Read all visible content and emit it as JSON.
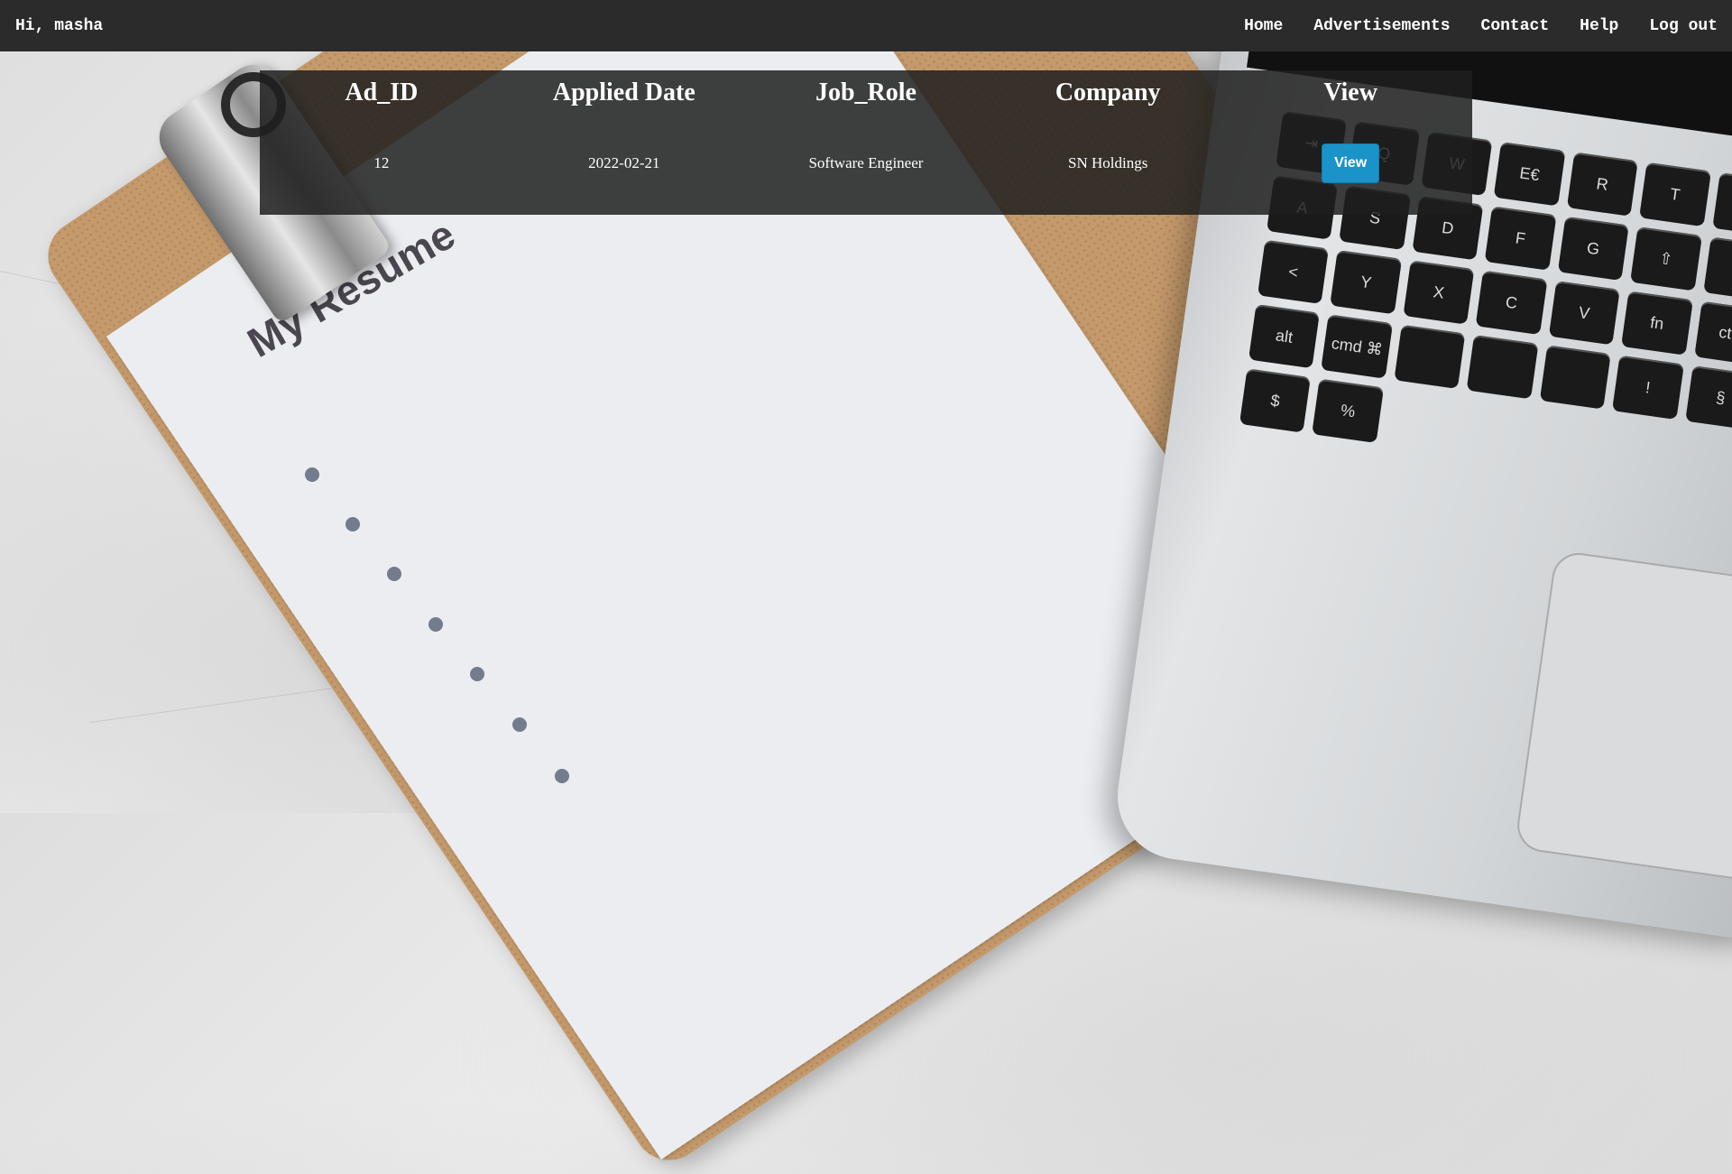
{
  "navbar": {
    "greeting": "Hi, masha",
    "links": [
      "Home",
      "Advertisements",
      "Contact",
      "Help",
      "Log out"
    ]
  },
  "table": {
    "headers": [
      "Ad_ID",
      "Applied Date",
      "Job_Role",
      "Company",
      "View"
    ],
    "rows": [
      {
        "ad_id": "12",
        "applied_date": "2022-02-21",
        "job_role": "Software Engineer",
        "company": "SN Holdings",
        "view_label": "View"
      }
    ]
  },
  "background": {
    "paper_title": "My Resume",
    "keys": [
      "⇥",
      "Q",
      "W",
      "E€",
      "R",
      "T",
      "⇪",
      "A",
      "S",
      "D",
      "F",
      "G",
      "⇧",
      ">",
      "<",
      "Y",
      "X",
      "C",
      "V",
      "fn",
      "ctrl",
      "alt",
      "cmd ⌘",
      "",
      "",
      "",
      "!",
      "§",
      "$",
      "%"
    ]
  },
  "colors": {
    "navbar_bg": "#2b2b2b",
    "panel_bg": "rgba(30,30,30,0.85)",
    "button_bg": "#1a93c8"
  }
}
